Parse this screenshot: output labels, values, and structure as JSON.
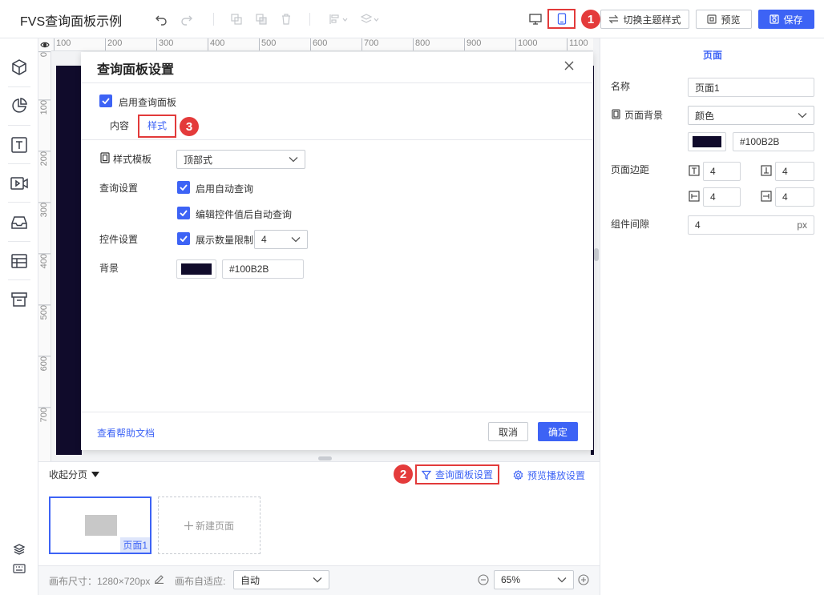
{
  "header": {
    "title": "FVS查询面板示例",
    "theme_button": "切换主题样式",
    "preview_button": "预览",
    "save_button": "保存",
    "badge_1": "1"
  },
  "ruler": {
    "top_ticks": [
      "100",
      "200",
      "300",
      "400",
      "500",
      "600",
      "700",
      "800",
      "900",
      "1000",
      "1100"
    ],
    "left_ticks": [
      "0",
      "100",
      "200",
      "300",
      "400",
      "500",
      "600",
      "700"
    ]
  },
  "modal": {
    "title": "查询面板设置",
    "enable_label": "启用查询面板",
    "tabs": [
      {
        "label": "内容"
      },
      {
        "label": "样式"
      }
    ],
    "badge_3": "3",
    "style_template_label": "样式模板",
    "style_template_value": "顶部式",
    "query_settings_label": "查询设置",
    "auto_query_label": "启用自动查询",
    "edit_auto_query_label": "编辑控件值后自动查询",
    "control_settings_label": "控件设置",
    "show_count_label": "展示数量限制",
    "count_value": "4",
    "background_label": "背景",
    "background_hex": "#100B2B",
    "help_link": "查看帮助文档",
    "cancel_button": "取消",
    "ok_button": "确定"
  },
  "page_strip": {
    "collapse_label": "收起分页",
    "badge_2": "2",
    "query_panel_settings": "查询面板设置",
    "preview_play_settings": "预览播放设置",
    "page_1_label": "页面1",
    "new_page_label": "新建页面"
  },
  "status_bar": {
    "canvas_size_label": "画布尺寸：1280×720px",
    "canvas_adapt_label": "画布自适应:",
    "canvas_adapt_value": "自动",
    "zoom_value": "65%"
  },
  "right_panel": {
    "header": "页面",
    "name_label": "名称",
    "name_value": "页面1",
    "background_label": "页面背景",
    "background_type": "颜色",
    "background_hex": "#100B2B",
    "margin_label": "页面边距",
    "margins": {
      "top": "4",
      "bottom": "4",
      "left": "4",
      "right": "4"
    },
    "gap_label": "组件间隙",
    "gap_value": "4",
    "gap_unit": "px"
  },
  "colors": {
    "accent": "#3d63f5",
    "highlight_red": "#e23a3a",
    "page_background": "#100B2B"
  }
}
